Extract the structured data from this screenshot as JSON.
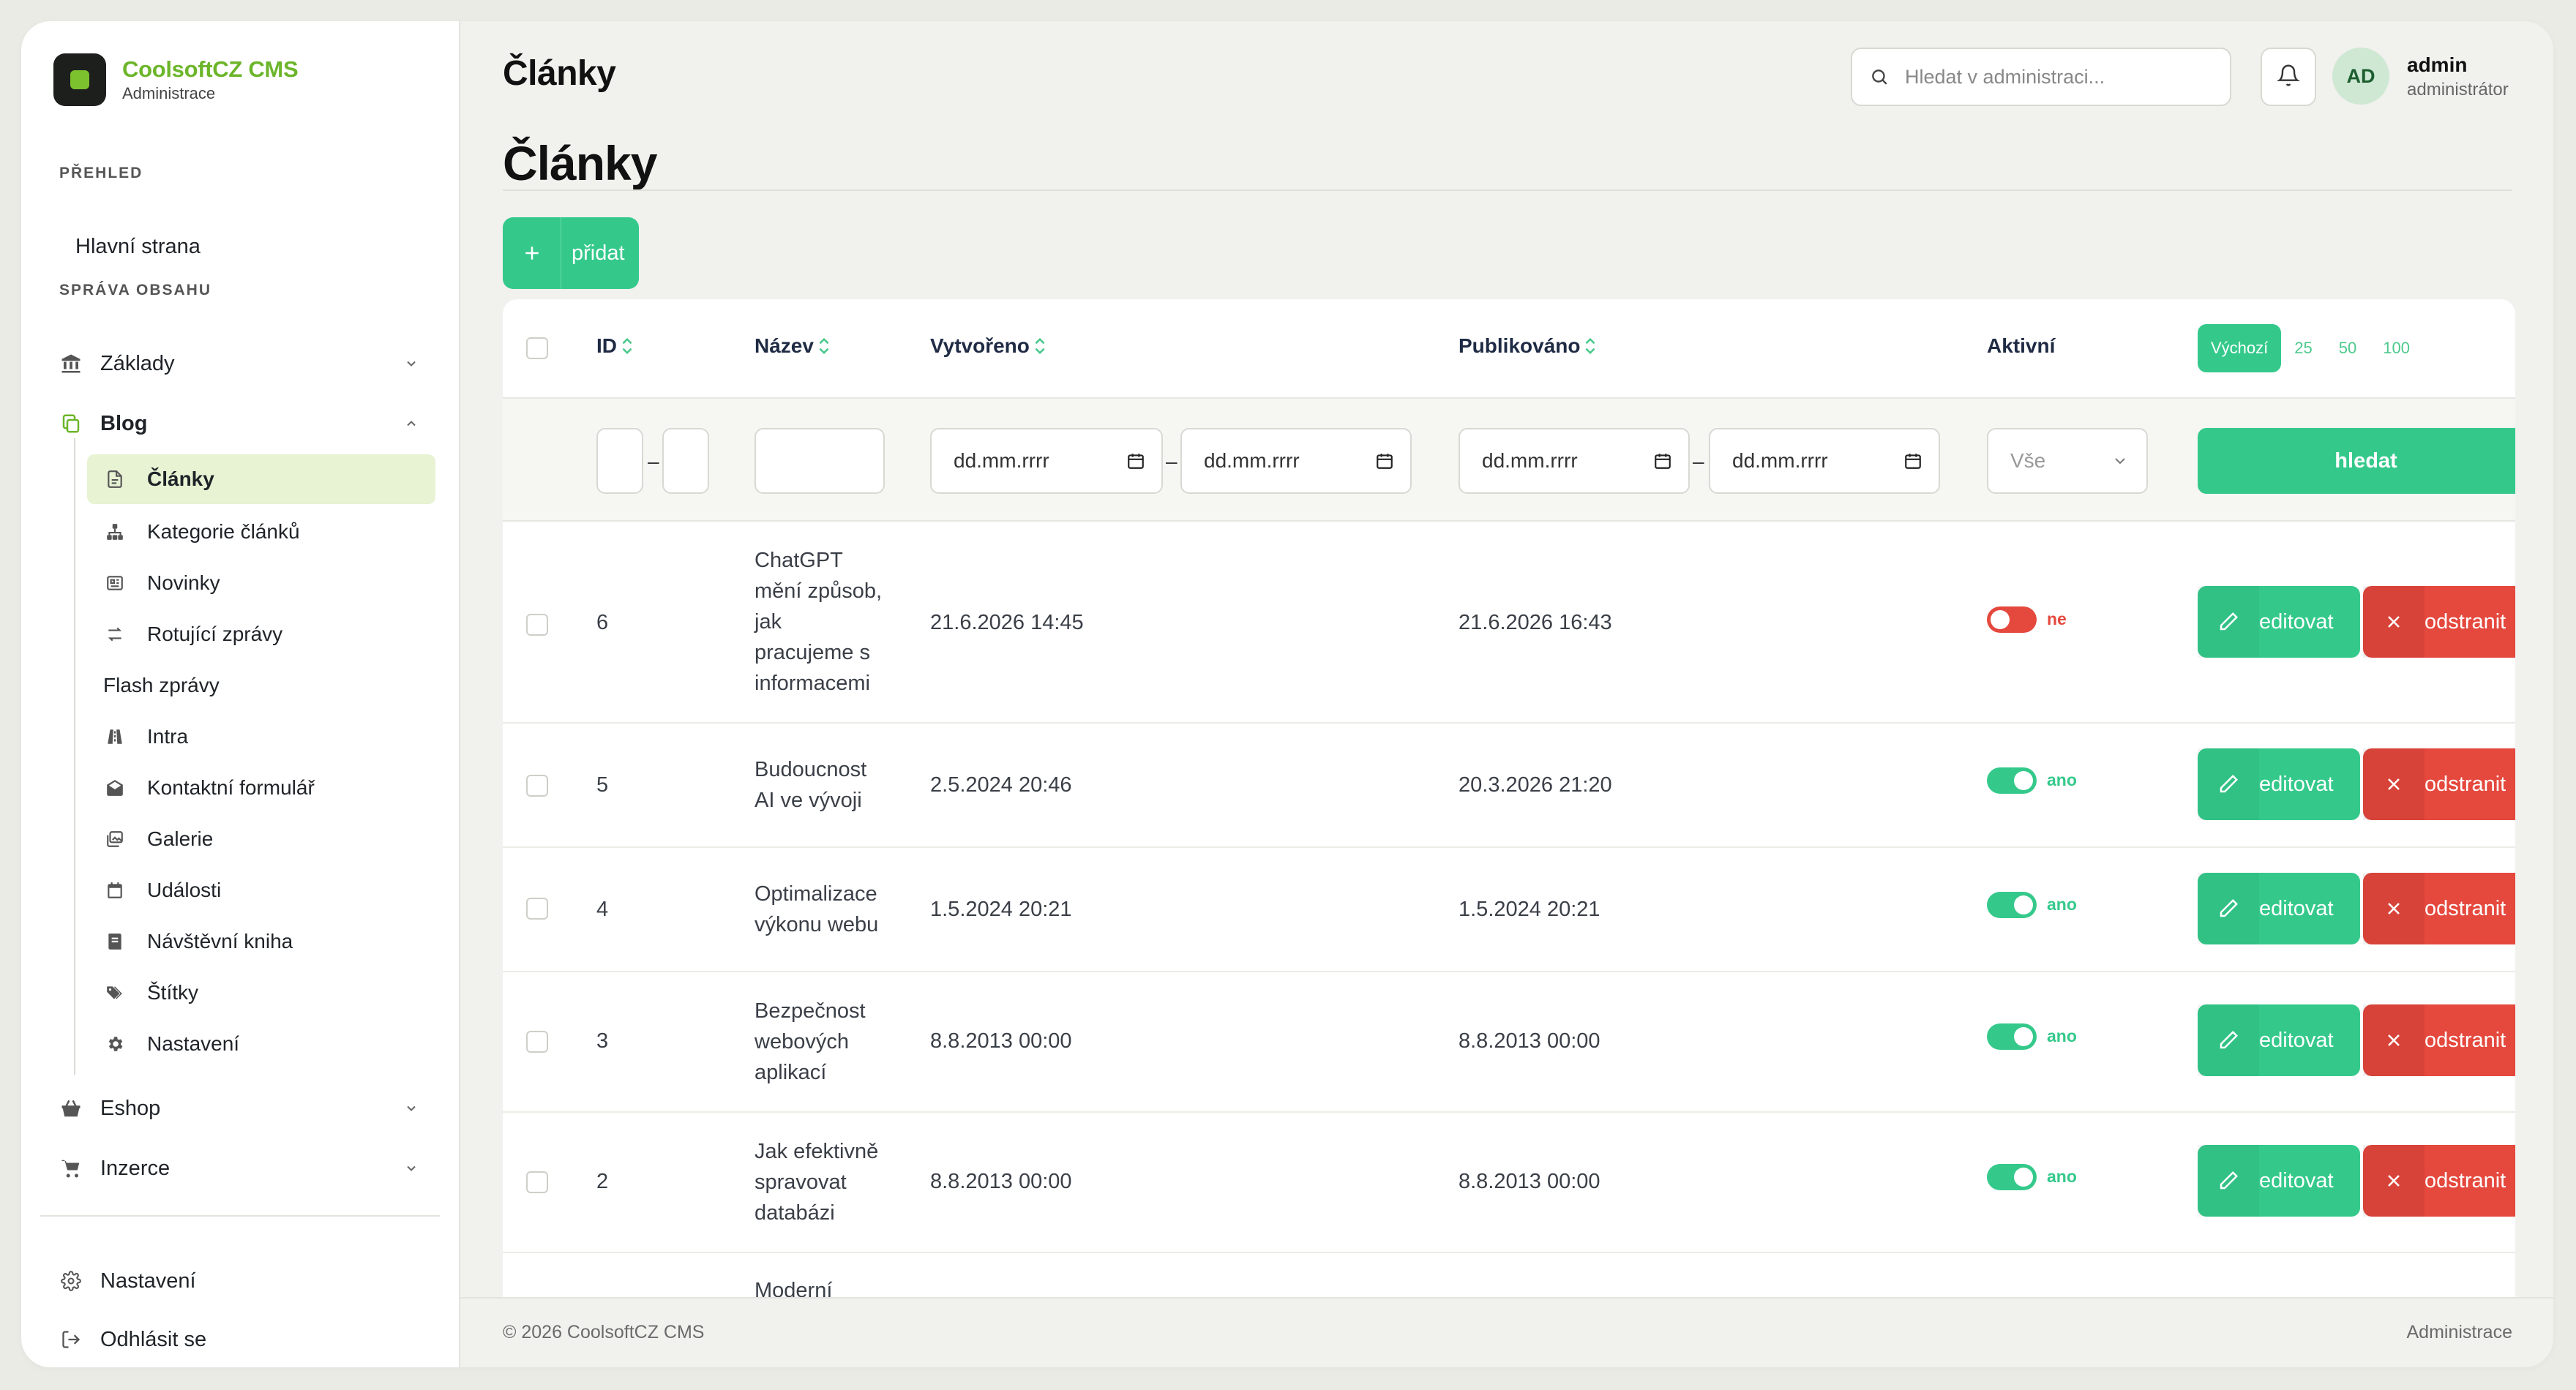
{
  "brand": {
    "name": "CoolsoftCZ CMS",
    "subtitle": "Administrace"
  },
  "sidebar": {
    "sections": [
      {
        "label": "PŘEHLED"
      },
      {
        "label": "SPRÁVA OBSAHU"
      }
    ],
    "home": "Hlavní strana",
    "groups": [
      {
        "label": "Základy",
        "icon": "bank-icon"
      },
      {
        "label": "Blog",
        "icon": "copy-icon"
      },
      {
        "label": "Eshop",
        "icon": "basket-icon"
      },
      {
        "label": "Inzerce",
        "icon": "cart-icon"
      }
    ],
    "blog_items": [
      {
        "label": "Články",
        "icon": "document-icon",
        "active": true
      },
      {
        "label": "Kategorie článků",
        "icon": "hierarchy-icon"
      },
      {
        "label": "Novinky",
        "icon": "newspaper-icon"
      },
      {
        "label": "Rotující zprávy",
        "icon": "arrows-icon"
      },
      {
        "label": "Flash zprávy",
        "icon": ""
      },
      {
        "label": "Intra",
        "icon": "road-icon"
      },
      {
        "label": "Kontaktní formulář",
        "icon": "envelope-open-icon"
      },
      {
        "label": "Galerie",
        "icon": "images-icon"
      },
      {
        "label": "Události",
        "icon": "calendar-icon"
      },
      {
        "label": "Návštěvní kniha",
        "icon": "book-icon"
      },
      {
        "label": "Štítky",
        "icon": "tags-icon"
      },
      {
        "label": "Nastavení",
        "icon": "gear-icon"
      }
    ],
    "bottom": {
      "settings": "Nastavení",
      "logout": "Odhlásit se"
    }
  },
  "topbar": {
    "title": "Články",
    "search_placeholder": "Hledat v administraci...",
    "user": {
      "initials": "AD",
      "name": "admin",
      "role": "administrátor"
    }
  },
  "page": {
    "heading": "Články",
    "add_label": "přidat"
  },
  "table": {
    "columns": {
      "id": "ID",
      "name": "Název",
      "created": "Vytvořeno",
      "published": "Publikováno",
      "active": "Aktivní"
    },
    "page_sizes": [
      "Výchozí",
      "25",
      "50",
      "100"
    ],
    "page_size_selected": "Výchozí",
    "filters": {
      "date_placeholder": "dd.mm.rrrr",
      "active_select": "Vše",
      "range_separator": "–",
      "search_label": "hledat"
    },
    "edit_label": "editovat",
    "delete_label": "odstranit",
    "rows": [
      {
        "id": "6",
        "name": [
          "ChatGPT",
          "mění způsob,",
          "jak",
          "pracujeme s",
          "informacemi"
        ],
        "created": "21.6.2026 14:45",
        "published": "21.6.2026 16:43",
        "active": false,
        "active_label": "ne"
      },
      {
        "id": "5",
        "name": [
          "Budoucnost",
          "AI ve vývoji"
        ],
        "created": "2.5.2024 20:46",
        "published": "20.3.2026 21:20",
        "active": true,
        "active_label": "ano"
      },
      {
        "id": "4",
        "name": [
          "Optimalizace",
          "výkonu webu"
        ],
        "created": "1.5.2024 20:21",
        "published": "1.5.2024 20:21",
        "active": true,
        "active_label": "ano"
      },
      {
        "id": "3",
        "name": [
          "Bezpečnost",
          "webových",
          "aplikací"
        ],
        "created": "8.8.2013 00:00",
        "published": "8.8.2013 00:00",
        "active": true,
        "active_label": "ano"
      },
      {
        "id": "2",
        "name": [
          "Jak efektivně",
          "spravovat",
          "databázi"
        ],
        "created": "8.8.2013 00:00",
        "published": "8.8.2013 00:00",
        "active": true,
        "active_label": "ano"
      },
      {
        "id": "",
        "name": [
          "Moderní"
        ],
        "created": "",
        "published": "",
        "active": true,
        "active_label": ""
      }
    ]
  },
  "footer": {
    "copyright": "© 2026 CoolsoftCZ CMS",
    "right": "Administrace"
  },
  "colors": {
    "accent": "#34c98b",
    "danger": "#e5483d",
    "brand": "#6cb52a"
  }
}
